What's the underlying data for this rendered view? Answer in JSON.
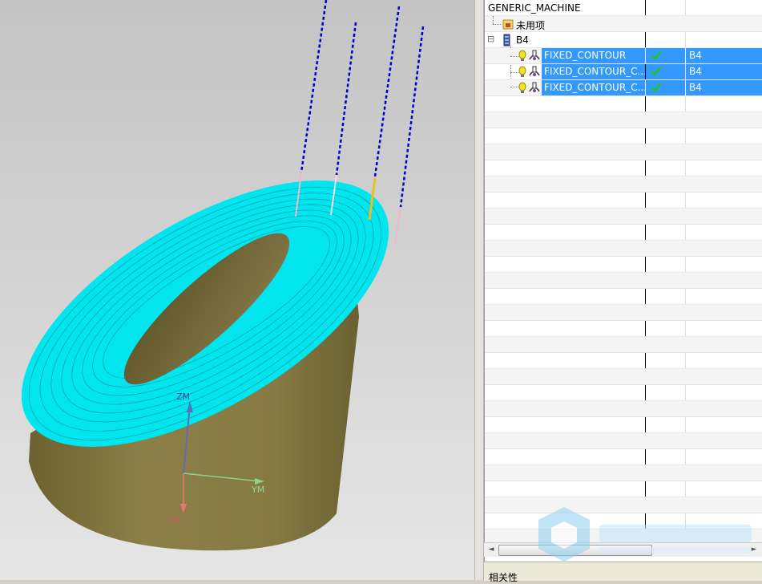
{
  "viewport": {
    "axes": {
      "z_label": "ZM",
      "y_label": "YM",
      "x_label": "XM"
    },
    "colors": {
      "toolpath": "#00ffff",
      "part": "#8a7e45",
      "tool_axis": "#0000cc"
    }
  },
  "navigator": {
    "root": {
      "label": "GENERIC_MACHINE",
      "icon": "machine-icon"
    },
    "unused": {
      "label": "未用项",
      "icon": "folder-icon"
    },
    "program": {
      "label": "B4",
      "icon": "program-icon",
      "expander": "⊟"
    },
    "operations": [
      {
        "name": "FIXED_CONTOUR",
        "status_icon": "check-icon",
        "position": "B4"
      },
      {
        "name": "FIXED_CONTOUR_C...",
        "status_icon": "check-icon",
        "position": "B4"
      },
      {
        "name": "FIXED_CONTOUR_C...",
        "status_icon": "check-icon",
        "position": "B4"
      }
    ],
    "scroll": {
      "left": "◄",
      "right": "►"
    }
  },
  "bottom_panel": {
    "label": "相关性"
  }
}
